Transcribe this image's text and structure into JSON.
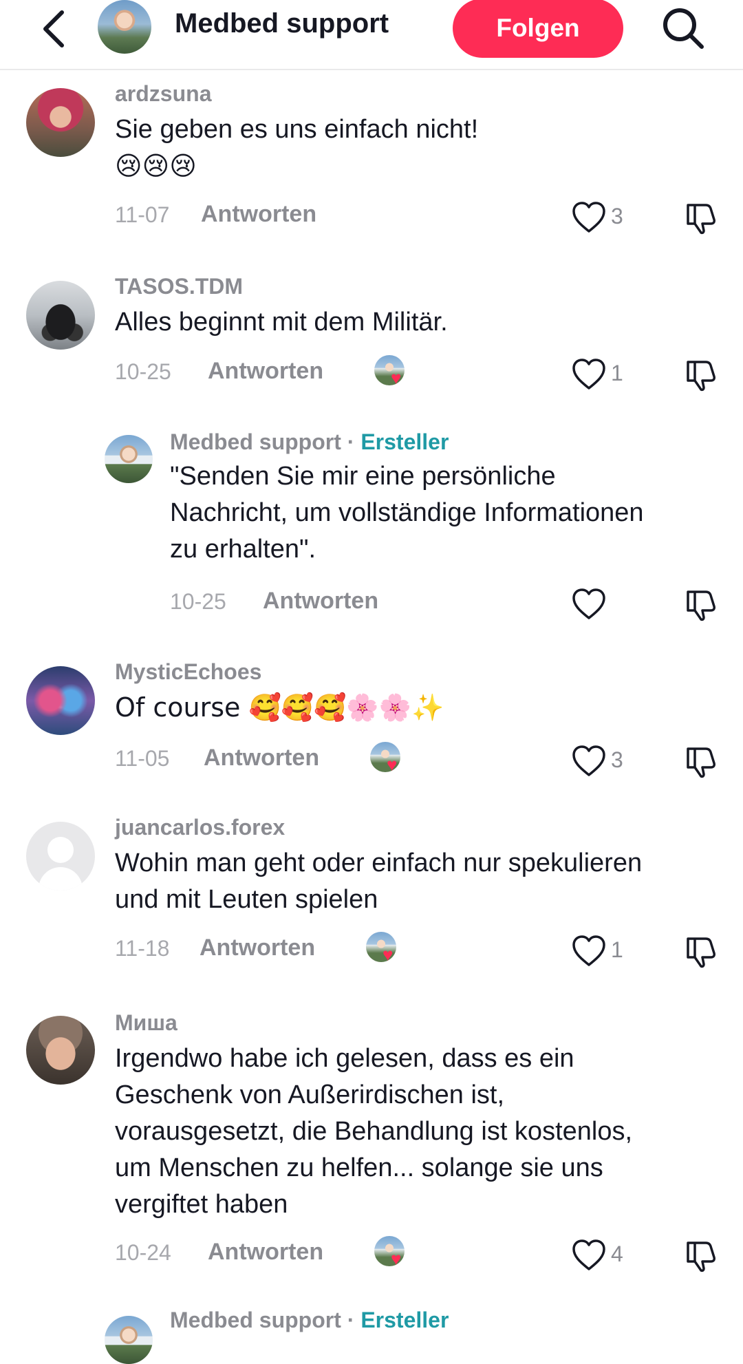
{
  "header": {
    "title": "Medbed support",
    "follow_label": "Folgen"
  },
  "reply_label": "Antworten",
  "comments": [
    {
      "user": "ardzsuna",
      "text_line1": "Sie geben es uns einfach nicht!",
      "text_line2": "😢😢😢",
      "date": "11-07",
      "likes": "3"
    },
    {
      "user": "TASOS.TDM",
      "text": "Alles beginnt mit dem Militär.",
      "date": "10-25",
      "likes": "1"
    },
    {
      "user": "Medbed support",
      "creator_sep": " · ",
      "creator_label": "Ersteller",
      "text_line1": "\"Senden Sie mir eine persönliche",
      "text_line2": "Nachricht, um vollständige Informationen",
      "text_line3": "zu erhalten\".",
      "date": "10-25",
      "likes": ""
    },
    {
      "user": "MysticEchoes",
      "text": "Of course 🥰🥰🥰🌸🌸✨",
      "date": "11-05",
      "likes": "3"
    },
    {
      "user": "juancarlos.forex",
      "text_line1": "Wohin man geht oder einfach nur spekulieren",
      "text_line2": "und mit Leuten spielen",
      "date": "11-18",
      "likes": "1"
    },
    {
      "user": "Миша",
      "text_line1": "Irgendwo habe ich gelesen, dass es ein",
      "text_line2": "Geschenk von Außerirdischen ist,",
      "text_line3": "vorausgesetzt, die Behandlung ist kostenlos,",
      "text_line4": "um Menschen zu helfen... solange sie uns",
      "text_line5": "vergiftet haben",
      "date": "10-24",
      "likes": "4"
    },
    {
      "user": "Medbed support",
      "creator_sep": " · ",
      "creator_label": "Ersteller"
    }
  ]
}
